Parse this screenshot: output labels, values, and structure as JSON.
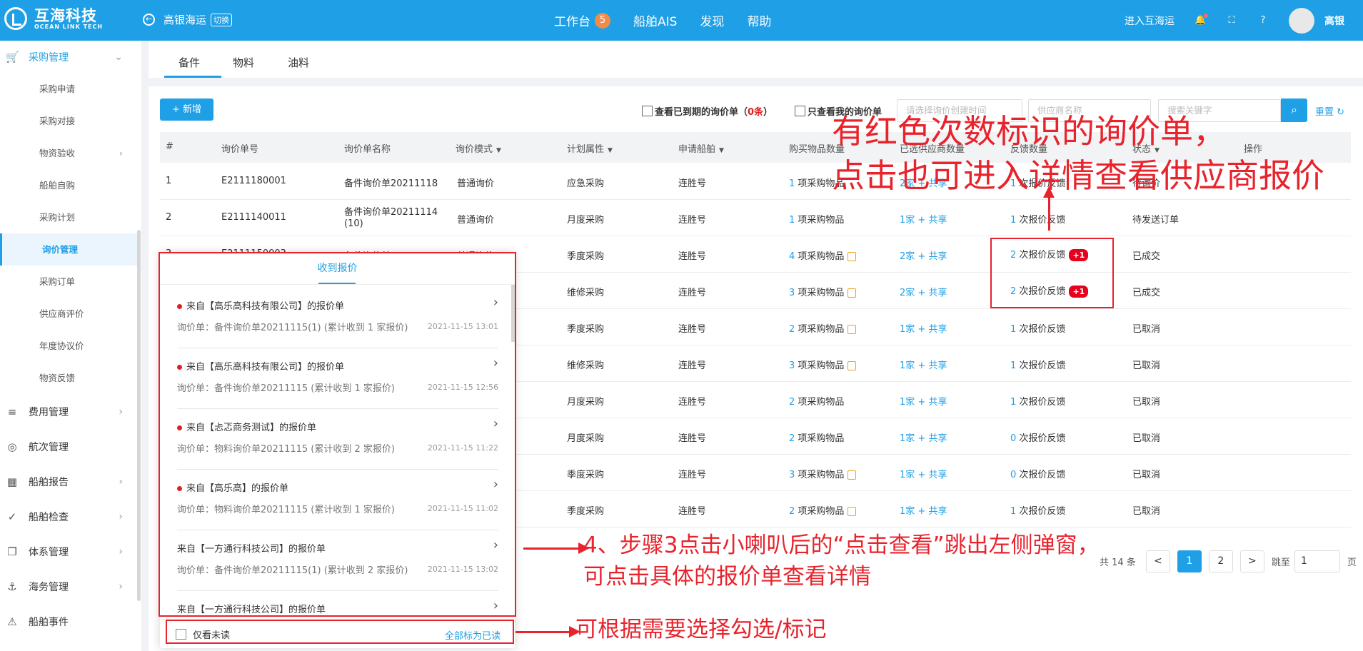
{
  "topbar": {
    "logo_cn": "互海科技",
    "logo_en": "OCEAN LINK TECH",
    "company": "高银海运",
    "switch_label": "切换",
    "nav": [
      {
        "label": "工作台",
        "badge": "5"
      },
      {
        "label": "船舶AIS"
      },
      {
        "label": "发现"
      },
      {
        "label": "帮助"
      }
    ],
    "enter_label": "进入互海运",
    "username": "高银"
  },
  "sidebar": {
    "procurement": "采购管理",
    "procurement_subs": [
      "采购申请",
      "采购对接",
      "物资验收",
      "船舶自购",
      "采购计划",
      "询价管理",
      "采购订单",
      "供应商评价",
      "年度协议价",
      "物资反馈"
    ],
    "groups": [
      "费用管理",
      "航次管理",
      "船舶报告",
      "船舶检查",
      "体系管理",
      "海务管理",
      "船舶事件"
    ]
  },
  "tabs": [
    "备件",
    "物料",
    "油料"
  ],
  "toolbar": {
    "add_label": "+ 新增",
    "chk_expired_pre": "查看已到期的询价单（",
    "chk_expired_num": "0条",
    "chk_expired_post": "）",
    "chk_mine": "只查看我的询价单",
    "date_placeholder": "请选择询价创建时间",
    "supplier_placeholder": "供应商名称",
    "keyword_placeholder": "搜索关键字",
    "reset_label": "重置"
  },
  "table": {
    "headers": [
      "#",
      "询价单号",
      "询价单名称",
      "询价模式",
      "计划属性",
      "申请船舶",
      "购买物品数量",
      "已选供应商数量",
      "反馈数量",
      "状态",
      "操作"
    ],
    "rows": [
      {
        "idx": "1",
        "no": "E2111180001",
        "name": "备件询价单20211118",
        "name2": "",
        "mode": "普通询价",
        "plan": "应急采购",
        "ship": "连胜号",
        "qty_n": "1",
        "qty": "项采购物品",
        "doc": false,
        "sup_n": "2",
        "sup": "家 + 共享",
        "fb_n": "1",
        "fb": "次报价反馈",
        "plus": "",
        "status": "待询价"
      },
      {
        "idx": "2",
        "no": "E2111140011",
        "name": "备件询价单20211114",
        "name2": "(10)",
        "mode": "普通询价",
        "plan": "月度采购",
        "ship": "连胜号",
        "qty_n": "1",
        "qty": "项采购物品",
        "doc": false,
        "sup_n": "1",
        "sup": "家 + 共享",
        "fb_n": "1",
        "fb": "次报价反馈",
        "plus": "",
        "status": "待发送订单"
      },
      {
        "idx": "3",
        "no": "E2111150003",
        "name": "备件询价单20211115",
        "name2": "",
        "mode": "普通询价",
        "plan": "季度采购",
        "ship": "连胜号",
        "qty_n": "4",
        "qty": "项采购物品",
        "doc": true,
        "sup_n": "2",
        "sup": "家 + 共享",
        "fb_n": "2",
        "fb": "次报价反馈",
        "plus": "+1",
        "status": "已成交"
      },
      {
        "idx": "4",
        "no": "",
        "name": "",
        "name2": "",
        "mode": "",
        "plan": "维修采购",
        "ship": "连胜号",
        "qty_n": "3",
        "qty": "项采购物品",
        "doc": true,
        "sup_n": "2",
        "sup": "家 + 共享",
        "fb_n": "2",
        "fb": "次报价反馈",
        "plus": "+1",
        "status": "已成交"
      },
      {
        "idx": "5",
        "no": "",
        "name": "",
        "name2": "",
        "mode": "",
        "plan": "季度采购",
        "ship": "连胜号",
        "qty_n": "2",
        "qty": "项采购物品",
        "doc": true,
        "sup_n": "1",
        "sup": "家 + 共享",
        "fb_n": "1",
        "fb": "次报价反馈",
        "plus": "",
        "status": "已取消"
      },
      {
        "idx": "6",
        "no": "",
        "name": "",
        "name2": "",
        "mode": "",
        "plan": "维修采购",
        "ship": "连胜号",
        "qty_n": "3",
        "qty": "项采购物品",
        "doc": true,
        "sup_n": "1",
        "sup": "家 + 共享",
        "fb_n": "1",
        "fb": "次报价反馈",
        "plus": "",
        "status": "已取消"
      },
      {
        "idx": "7",
        "no": "",
        "name": "",
        "name2": "",
        "mode": "",
        "plan": "月度采购",
        "ship": "连胜号",
        "qty_n": "2",
        "qty": "项采购物品",
        "doc": false,
        "sup_n": "1",
        "sup": "家 + 共享",
        "fb_n": "1",
        "fb": "次报价反馈",
        "plus": "",
        "status": "已取消"
      },
      {
        "idx": "8",
        "no": "",
        "name": "",
        "name2": "",
        "mode": "",
        "plan": "月度采购",
        "ship": "连胜号",
        "qty_n": "2",
        "qty": "项采购物品",
        "doc": false,
        "sup_n": "1",
        "sup": "家 + 共享",
        "fb_n": "0",
        "fb": "次报价反馈",
        "plus": "",
        "status": "已取消"
      },
      {
        "idx": "9",
        "no": "",
        "name": "",
        "name2": "",
        "mode": "",
        "plan": "季度采购",
        "ship": "连胜号",
        "qty_n": "3",
        "qty": "项采购物品",
        "doc": true,
        "sup_n": "1",
        "sup": "家 + 共享",
        "fb_n": "0",
        "fb": "次报价反馈",
        "plus": "",
        "status": "已取消"
      },
      {
        "idx": "10",
        "no": "",
        "name": "",
        "name2": "",
        "mode": "",
        "plan": "季度采购",
        "ship": "连胜号",
        "qty_n": "2",
        "qty": "项采购物品",
        "doc": true,
        "sup_n": "1",
        "sup": "家 + 共享",
        "fb_n": "1",
        "fb": "次报价反馈",
        "plus": "",
        "status": "已取消"
      }
    ]
  },
  "pager": {
    "total": "共 14 条",
    "prev": "<",
    "p1": "1",
    "p2": "2",
    "next": ">",
    "jump": "跳至",
    "jump_val": "1",
    "page": "页"
  },
  "popup": {
    "title": "收到报价",
    "messages": [
      {
        "unread": true,
        "title": "来自【高乐高科技有限公司】的报价单",
        "detail": "询价单：备件询价单20211115(1) (累计收到 1 家报价)",
        "time": "2021-11-15 13:01"
      },
      {
        "unread": true,
        "title": "来自【高乐高科技有限公司】的报价单",
        "detail": "询价单：备件询价单20211115 (累计收到 1 家报价)",
        "time": "2021-11-15 12:56"
      },
      {
        "unread": true,
        "title": "来自【忐忑商务测试】的报价单",
        "detail": "询价单：物料询价单20211115 (累计收到 2 家报价)",
        "time": "2021-11-15 11:22"
      },
      {
        "unread": true,
        "title": "来自【高乐高】的报价单",
        "detail": "询价单：物料询价单20211115 (累计收到 1 家报价)",
        "time": "2021-11-15 11:02"
      },
      {
        "unread": false,
        "title": "来自【一方通行科技公司】的报价单",
        "detail": "询价单：备件询价单20211115(1) (累计收到 2 家报价)",
        "time": "2021-11-15 13:02"
      },
      {
        "unread": false,
        "title": "来自【一方通行科技公司】的报价单",
        "detail": "",
        "time": ""
      }
    ],
    "only_unread": "仅看未读",
    "mark_all": "全部标为已读"
  },
  "annotations": {
    "top_line1": "有红色次数标识的询价单，",
    "top_line2": "点击也可进入详情查看供应商报价",
    "mid_line1": "4、步骤3点击小喇叭后的“点击查看”跳出左侧弹窗，",
    "mid_line2": "可点击具体的报价单查看详情",
    "bottom": "可根据需要选择勾选/标记"
  },
  "colors": {
    "brand": "#1e9fe6",
    "annotation": "#e8232c",
    "badge": "#e8001c"
  }
}
